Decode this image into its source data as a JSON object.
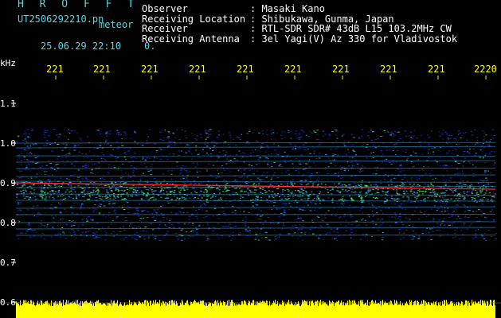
{
  "header": {
    "brand": "H R O F F T",
    "filename": "UT2506292210.pn",
    "meteor_label": "meteor",
    "datetime": "25.06.29 22:10",
    "count": "0",
    "info": [
      {
        "label": "Observer",
        "value": ": Masaki Kano"
      },
      {
        "label": "Receiving Location",
        "value": ": Shibukawa, Gunma, Japan"
      },
      {
        "label": "Receiver",
        "value": ": RTL-SDR SDR# 43dB L15 103.2MHz CW"
      },
      {
        "label": "Receiving Antenna",
        "value": ": 3el Yagi(V) Az 330 for Vladivostok"
      }
    ]
  },
  "axes": {
    "y_unit": "kHz",
    "y_ticks": [
      "1.1",
      "1.0",
      "0.9",
      "0.8",
      "0.7",
      "0.6"
    ],
    "x_ticks": [
      "221",
      "221",
      "221",
      "221",
      "221",
      "221",
      "221",
      "221",
      "221",
      "2220"
    ]
  },
  "colors": {
    "background": "#000000",
    "text_cyan": "#5fd4e0",
    "text_yellow": "#ffff00",
    "signal_low": "#1a2fb0",
    "signal_mid": "#2a9ad8",
    "signal_high": "#3ee04a",
    "signal_peak": "#ff2a2a"
  }
}
